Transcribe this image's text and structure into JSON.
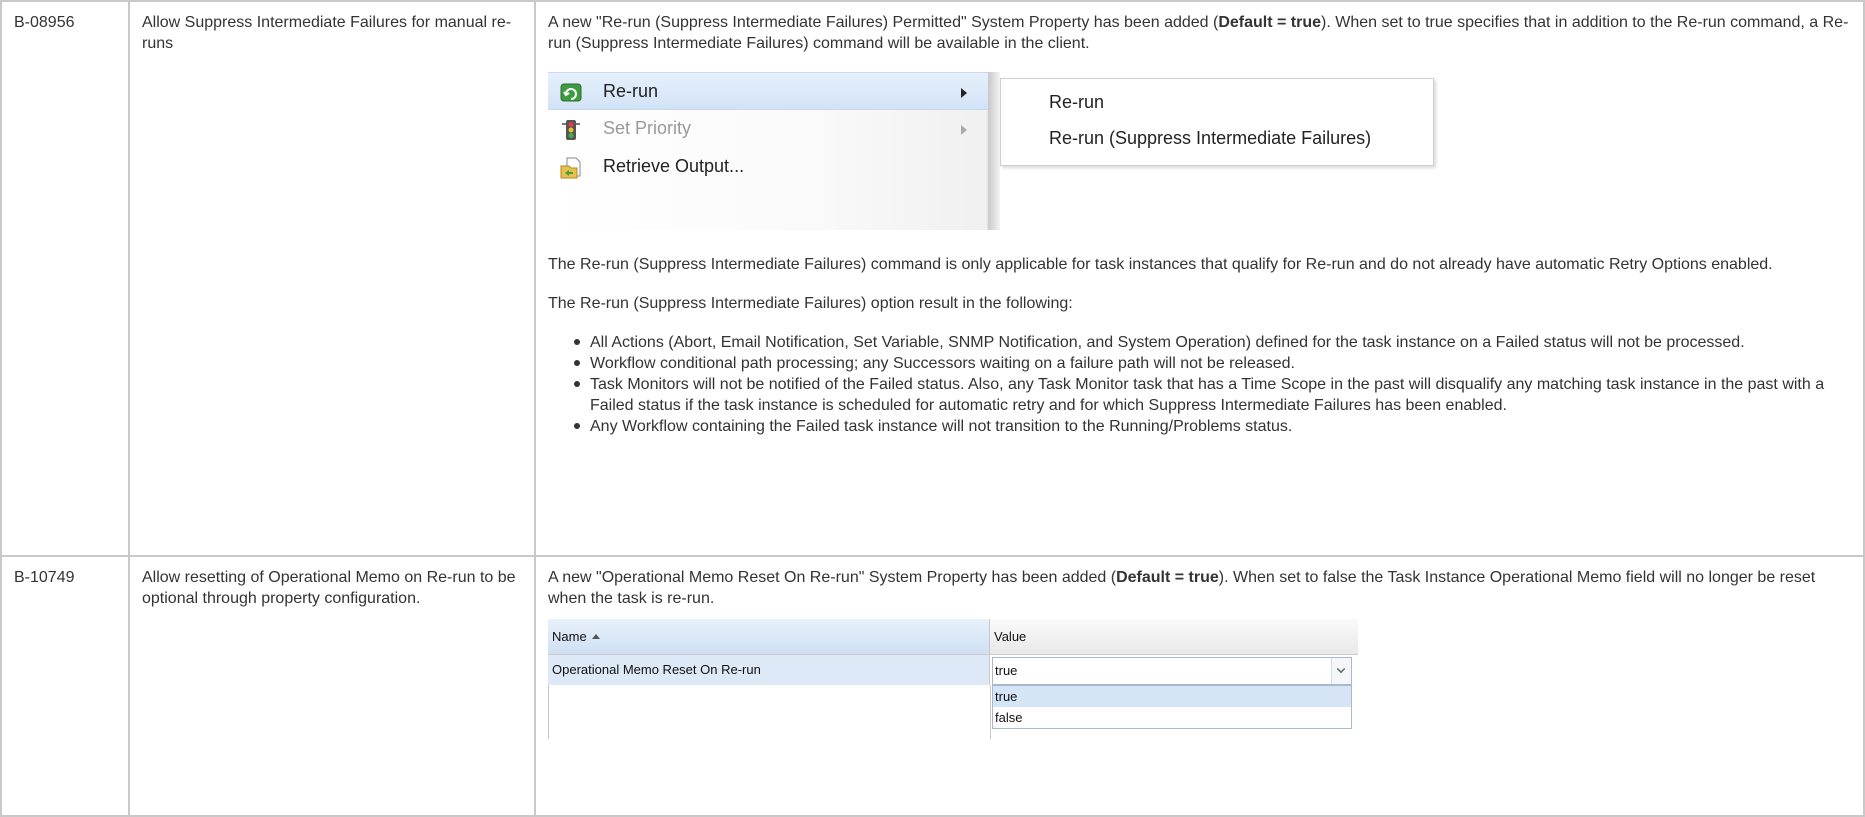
{
  "rows": [
    {
      "id": "B-08956",
      "summary": "Allow Suppress Intermediate Failures for manual re-runs",
      "desc": {
        "p1_pre": "A new \"Re-run (Suppress Intermediate Failures) Permitted\" System Property has been added (",
        "p1_bold": "Default = true",
        "p1_post": "). When set to true specifies that in addition to the Re-run command, a Re-run (Suppress Intermediate Failures) command will be available in the client.",
        "p2": "The Re-run (Suppress Intermediate Failures) command is only applicable for task instances that qualify for Re-run and do not already have automatic Retry Options enabled.",
        "p3": "The Re-run (Suppress Intermediate Failures) option result in the following:",
        "bullets": [
          "All Actions (Abort, Email Notification, Set Variable, SNMP Notification, and System Operation) defined for the task instance on a Failed status will not be processed.",
          "Workflow conditional path processing; any Successors waiting on a failure path will not be released.",
          "Task Monitors will not be notified of the Failed status. Also, any Task Monitor task that has a Time Scope in the past will disqualify any matching task instance in the past with a Failed status if the task instance is scheduled for automatic retry and for which Suppress Intermediate Failures has been enabled.",
          "Any Workflow containing the Failed task instance will not transition to the Running/Problems status."
        ]
      },
      "menu": {
        "items": [
          {
            "label": "Re-run",
            "icon": "rerun-icon"
          },
          {
            "label": "Set Priority",
            "icon": "traffic-light-icon"
          },
          {
            "label": "Retrieve Output...",
            "icon": "retrieve-output-icon"
          }
        ],
        "submenu": [
          "Re-run",
          "Re-run (Suppress Intermediate Failures)"
        ]
      }
    },
    {
      "id": "B-10749",
      "summary": "Allow resetting of Operational Memo on Re-run to be optional through property configuration.",
      "desc": {
        "p1_pre": "A new \"Operational Memo Reset On Re-run\" System Property has been added (",
        "p1_bold": "Default = true",
        "p1_post": "). When set to false the Task Instance Operational Memo field will no longer be reset when the task is re-run."
      },
      "grid": {
        "col_name": "Name",
        "col_value": "Value",
        "row_name": "Operational Memo Reset On Re-run",
        "row_value": "true",
        "options": [
          "true",
          "false"
        ],
        "sorted_icon": "sort-ascending-icon",
        "dropdown_icon": "chevron-down-icon"
      }
    }
  ]
}
